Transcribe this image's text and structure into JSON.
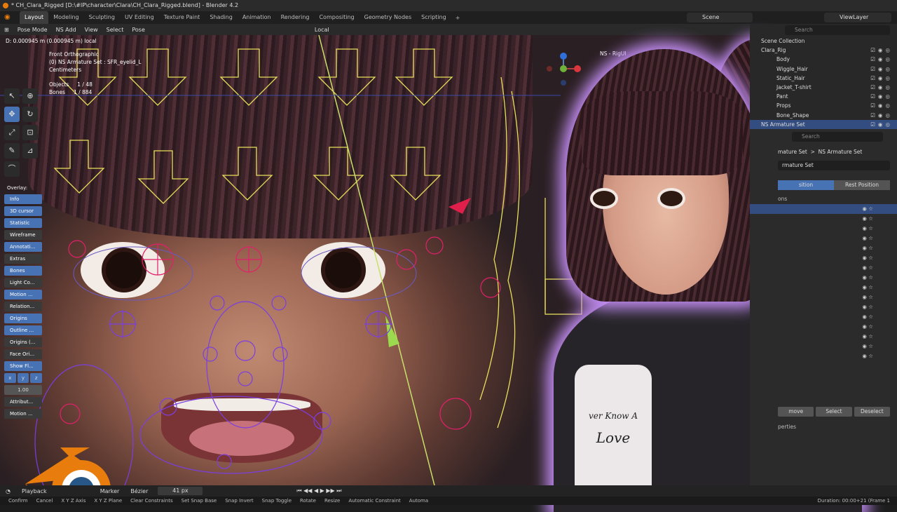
{
  "window": {
    "title": "* CH_Clara_Rigged [D:\\#IP\\character\\Clara\\CH_Clara_Rigged.blend] - Blender 4.2"
  },
  "menubar": {
    "tabs": [
      "Layout",
      "Modeling",
      "Sculpting",
      "UV Editing",
      "Texture Paint",
      "Shading",
      "Animation",
      "Rendering",
      "Compositing",
      "Geometry Nodes",
      "Scripting"
    ],
    "add_tab": "+",
    "scene": "Scene",
    "view_layer": "ViewLayer"
  },
  "viewport_header": {
    "mode": "Pose Mode",
    "menus": [
      "NS Add",
      "View",
      "Select",
      "Pose"
    ],
    "pivot": "Local",
    "search_placeholder": "Search"
  },
  "viewport": {
    "header_info": "D: 0.000945 m (0.000945 m) local",
    "view_name": "Front Orthographic",
    "active": "(0) NS Armature Set : SFR_eyelid_L",
    "units": "Centimeters",
    "objects_label": "Objects",
    "objects_value": "1 / 48",
    "bones_label": "Bones",
    "bones_value": "1 / 884",
    "rig_ui_label": "NS - RigUI"
  },
  "overlay_panel": {
    "title": "Overlay:",
    "items": [
      {
        "label": "Info",
        "on": true
      },
      {
        "label": "3D cursor",
        "on": true
      },
      {
        "label": "Statistic",
        "on": true
      },
      {
        "label": "Wireframe",
        "on": false
      },
      {
        "label": "Annotati...",
        "on": true
      },
      {
        "label": "Extras",
        "on": false
      },
      {
        "label": "Bones",
        "on": true
      },
      {
        "label": "Light Co...",
        "on": false
      },
      {
        "label": "Motion ...",
        "on": true
      },
      {
        "label": "Relation...",
        "on": false
      },
      {
        "label": "Origins",
        "on": true
      },
      {
        "label": "Outline ...",
        "on": true
      },
      {
        "label": "Origins (...",
        "on": false
      },
      {
        "label": "Face Ori...",
        "on": false
      },
      {
        "label": "Show Fl...",
        "on": true
      }
    ],
    "axes": [
      "x",
      "y",
      "z"
    ],
    "value": "1.00",
    "bottom_items": [
      "Attribut...",
      "Motion ..."
    ]
  },
  "outliner": {
    "search_placeholder": "Search",
    "collection": "Scene Collection",
    "rows": [
      {
        "label": "Clara_Rig",
        "child": false,
        "selected": false
      },
      {
        "label": "Body",
        "child": true,
        "selected": false
      },
      {
        "label": "Wiggle_Hair",
        "child": true,
        "selected": false
      },
      {
        "label": "Static_Hair",
        "child": true,
        "selected": false
      },
      {
        "label": "Jacket_T-shirt",
        "child": true,
        "selected": false
      },
      {
        "label": "Pant",
        "child": true,
        "selected": false
      },
      {
        "label": "Props",
        "child": true,
        "selected": false
      },
      {
        "label": "Bone_Shape",
        "child": true,
        "selected": false
      },
      {
        "label": "NS Armature Set",
        "child": false,
        "selected": true
      }
    ]
  },
  "properties": {
    "search_placeholder": "Search",
    "breadcrumb_left": "mature Set",
    "breadcrumb_right": "NS Armature Set",
    "datablock": "rmature Set",
    "pose_position": "sition",
    "rest_position": "Rest Position",
    "section": "ons",
    "buttons": [
      "move",
      "Select",
      "Deselect"
    ],
    "footer": "perties"
  },
  "timeline": {
    "playback": "Playback",
    "marker": "Marker",
    "interpolation": "Bézier",
    "frame": "41 px"
  },
  "statusbar": {
    "items": [
      "Confirm",
      "Cancel",
      "X Y Z Axis",
      "X Y Z Plane",
      "Clear Constraints",
      "Set Snap Base",
      "Snap Invert",
      "Snap Toggle",
      "Rotate",
      "Resize",
      "Automatic Constraint",
      "Automa"
    ],
    "right": "Duration: 00:00+21 (Frame 1"
  },
  "shirt": {
    "line1": "ver Know A",
    "line2": "Love"
  },
  "colors": {
    "accent": "#4772b3",
    "blender_orange": "#e87d0d",
    "glow": "#c48ef5",
    "rig_yellow": "#e8e05a",
    "rig_red": "#e0206a",
    "rig_purple": "#8040e0"
  }
}
